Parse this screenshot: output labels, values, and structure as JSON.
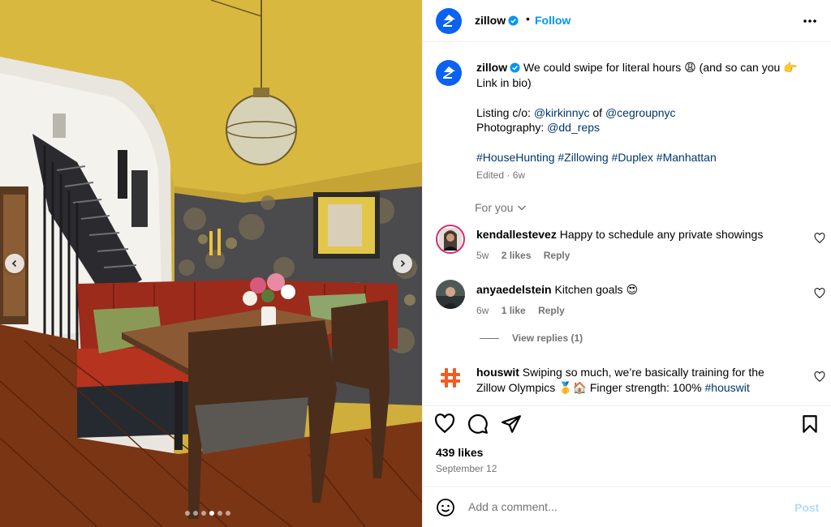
{
  "post": {
    "username": "zillow",
    "follow_label": "Follow",
    "header_separator": "•",
    "caption": {
      "username": "zillow",
      "line1": "We could swipe for literal hours 😩 (and so can you 👉",
      "line2": "Link in bio)",
      "listing_prefix": "Listing c/o: ",
      "listing_handle_1": "@kirkinnyc",
      "listing_join": " of ",
      "listing_handle_2": "@cegroupnyc",
      "photo_prefix": "Photography: ",
      "photo_handle": "@dd_reps",
      "hashtags": "#HouseHunting #Zillowing #Duplex #Manhattan",
      "edited": "Edited",
      "meta_sep": " · ",
      "age": "6w"
    },
    "for_you_label": "For you",
    "comments": [
      {
        "username": "kendallestevez",
        "text": "Happy to schedule any private showings",
        "age": "5w",
        "likes": "2 likes",
        "reply": "Reply"
      },
      {
        "username": "anyaedelstein",
        "text": "Kitchen goals 😍",
        "age": "6w",
        "likes": "1 like",
        "reply": "Reply"
      },
      {
        "username": "houswit",
        "text_line1": "Swiping so much, we’re basically training for the",
        "text_line2_prefix": "Zillow Olympics 🥇🏠 Finger strength: 100% ",
        "text_hashtag": "#houswit"
      }
    ],
    "view_replies_label": "View replies (1)",
    "likes_label": "439 likes",
    "date_label": "September 12",
    "add_comment_placeholder": "Add a comment...",
    "post_button_label": "Post",
    "carousel": {
      "total_slides": 6,
      "active_slide": 4
    }
  },
  "colors": {
    "brand_blue": "#0b62f0",
    "follow_blue": "#0095f6",
    "link_blue": "#00376b",
    "muted": "#737373",
    "post_disabled": "#b3dbff"
  },
  "icons": {
    "header_more": "more-horizontal-icon",
    "like": "heart-icon",
    "comment": "comment-icon",
    "share": "share-icon",
    "save": "bookmark-icon",
    "emoji": "emoji-icon"
  }
}
